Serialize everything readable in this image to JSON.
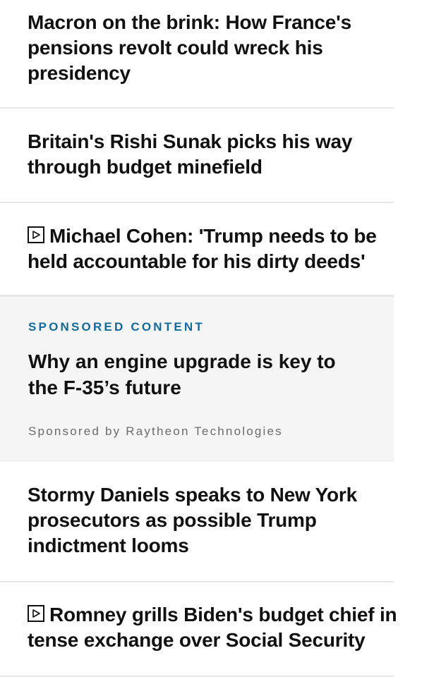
{
  "stories": [
    {
      "headline": "Macron on the brink: How France's pensions revolt could wreck his presidency",
      "video": false
    },
    {
      "headline": "Britain's Rishi Sunak picks his way through budget minefield",
      "video": false
    },
    {
      "headline": "Michael Cohen: 'Trump needs to be held accountable for his dirty deeds'",
      "video": true
    },
    {
      "headline": "Stormy Daniels speaks to New York prosecutors as possible Trump indictment looms",
      "video": false
    },
    {
      "headline": "Romney grills Biden's budget chief in tense exchange over Social Security",
      "video": true
    }
  ],
  "sponsored": {
    "label": "SPONSORED CONTENT",
    "title": "Why an engine upgrade is key to the F-35’s future",
    "sponsor": "Sponsored by Raytheon Technologies"
  },
  "icons": {
    "video": "play-icon"
  },
  "colors": {
    "sponsored_label": "#136a96",
    "sponsored_background": "#f5f5f5",
    "divider": "#e6e6e6"
  }
}
